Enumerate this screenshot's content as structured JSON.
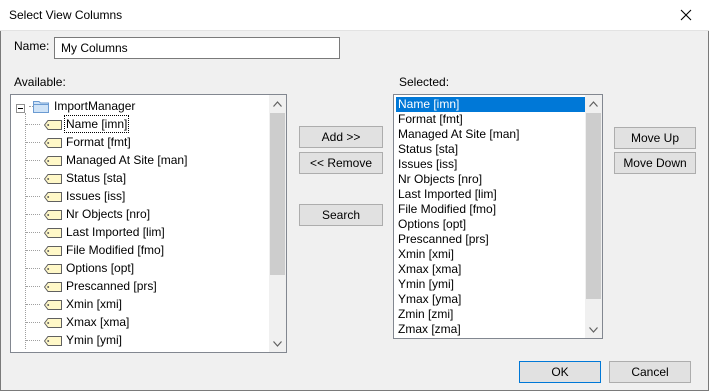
{
  "window": {
    "title": "Select View Columns"
  },
  "name_field": {
    "label": "Name:",
    "value": "My Columns"
  },
  "available": {
    "label": "Available:",
    "root": "ImportManager",
    "items": [
      "Name [imn]",
      "Format [fmt]",
      "Managed At Site [man]",
      "Status [sta]",
      "Issues [iss]",
      "Nr Objects [nro]",
      "Last Imported [lim]",
      "File Modified [fmo]",
      "Options [opt]",
      "Prescanned [prs]",
      "Xmin [xmi]",
      "Xmax [xma]",
      "Ymin [ymi]"
    ],
    "selected_index": 0
  },
  "selected": {
    "label": "Selected:",
    "items": [
      "Name [imn]",
      "Format [fmt]",
      "Managed At Site [man]",
      "Status [sta]",
      "Issues [iss]",
      "Nr Objects [nro]",
      "Last Imported [lim]",
      "File Modified [fmo]",
      "Options [opt]",
      "Prescanned [prs]",
      "Xmin [xmi]",
      "Xmax [xma]",
      "Ymin [ymi]",
      "Ymax [yma]",
      "Zmin [zmi]",
      "Zmax [zma]"
    ],
    "active_index": 0
  },
  "buttons": {
    "add": "Add >>",
    "remove": "<< Remove",
    "search": "Search",
    "move_up": "Move Up",
    "move_down": "Move Down",
    "ok": "OK",
    "cancel": "Cancel"
  },
  "colors": {
    "accent": "#0078d7",
    "dialog_bg": "#f0f0f0"
  }
}
